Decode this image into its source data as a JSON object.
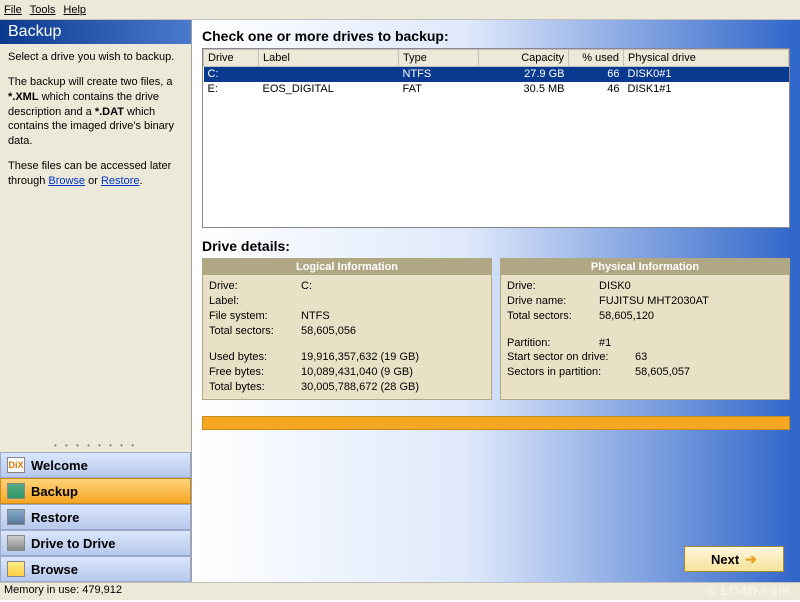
{
  "menu": {
    "file": "File",
    "tools": "Tools",
    "help": "Help"
  },
  "sidebar": {
    "title": "Backup",
    "para1": "Select a drive you wish to backup.",
    "para2a": "The backup will create two files, a ",
    "para2b": "*.XML",
    "para2c": " which contains the drive description and a ",
    "para2d": "*.DAT",
    "para2e": " which contains the imaged drive's binary data.",
    "para3a": "These files can be accessed later through ",
    "link_browse": "Browse",
    "para3b": " or ",
    "link_restore": "Restore",
    "para3c": ".",
    "nav": {
      "welcome": "Welcome",
      "backup": "Backup",
      "restore": "Restore",
      "d2d": "Drive to Drive",
      "browse": "Browse"
    }
  },
  "content": {
    "heading": "Check one or more drives to backup:",
    "columns": {
      "drive": "Drive",
      "label": "Label",
      "type": "Type",
      "capacity": "Capacity",
      "used": "% used",
      "physical": "Physical drive"
    },
    "rows": [
      {
        "drive": "C:",
        "label": "",
        "type": "NTFS",
        "capacity": "27.9 GB",
        "used": "66",
        "physical": "DISK0#1"
      },
      {
        "drive": "E:",
        "label": "EOS_DIGITAL",
        "type": "FAT",
        "capacity": "30.5 MB",
        "used": "46",
        "physical": "DISK1#1"
      }
    ],
    "details_heading": "Drive details:",
    "logical": {
      "title": "Logical Information",
      "drive_l": "Drive:",
      "drive_v": "C:",
      "label_l": "Label:",
      "label_v": "",
      "fs_l": "File system:",
      "fs_v": "NTFS",
      "ts_l": "Total sectors:",
      "ts_v": "58,605,056",
      "ub_l": "Used bytes:",
      "ub_v": "19,916,357,632 (19 GB)",
      "fb_l": "Free bytes:",
      "fb_v": "10,089,431,040 (9 GB)",
      "tb_l": "Total bytes:",
      "tb_v": "30,005,788,672 (28 GB)"
    },
    "physical": {
      "title": "Physical Information",
      "drive_l": "Drive:",
      "drive_v": "DISK0",
      "name_l": "Drive name:",
      "name_v": "FUJITSU MHT2030AT",
      "ts_l": "Total sectors:",
      "ts_v": "58,605,120",
      "part_l": "Partition:",
      "part_v": "#1",
      "ss_l": "Start sector on drive:",
      "ss_v": "63",
      "sp_l": "Sectors in partition:",
      "sp_v": "58,605,057"
    },
    "next": "Next"
  },
  "status": "Memory in use: 479,912",
  "watermark": "© LO4D.com"
}
